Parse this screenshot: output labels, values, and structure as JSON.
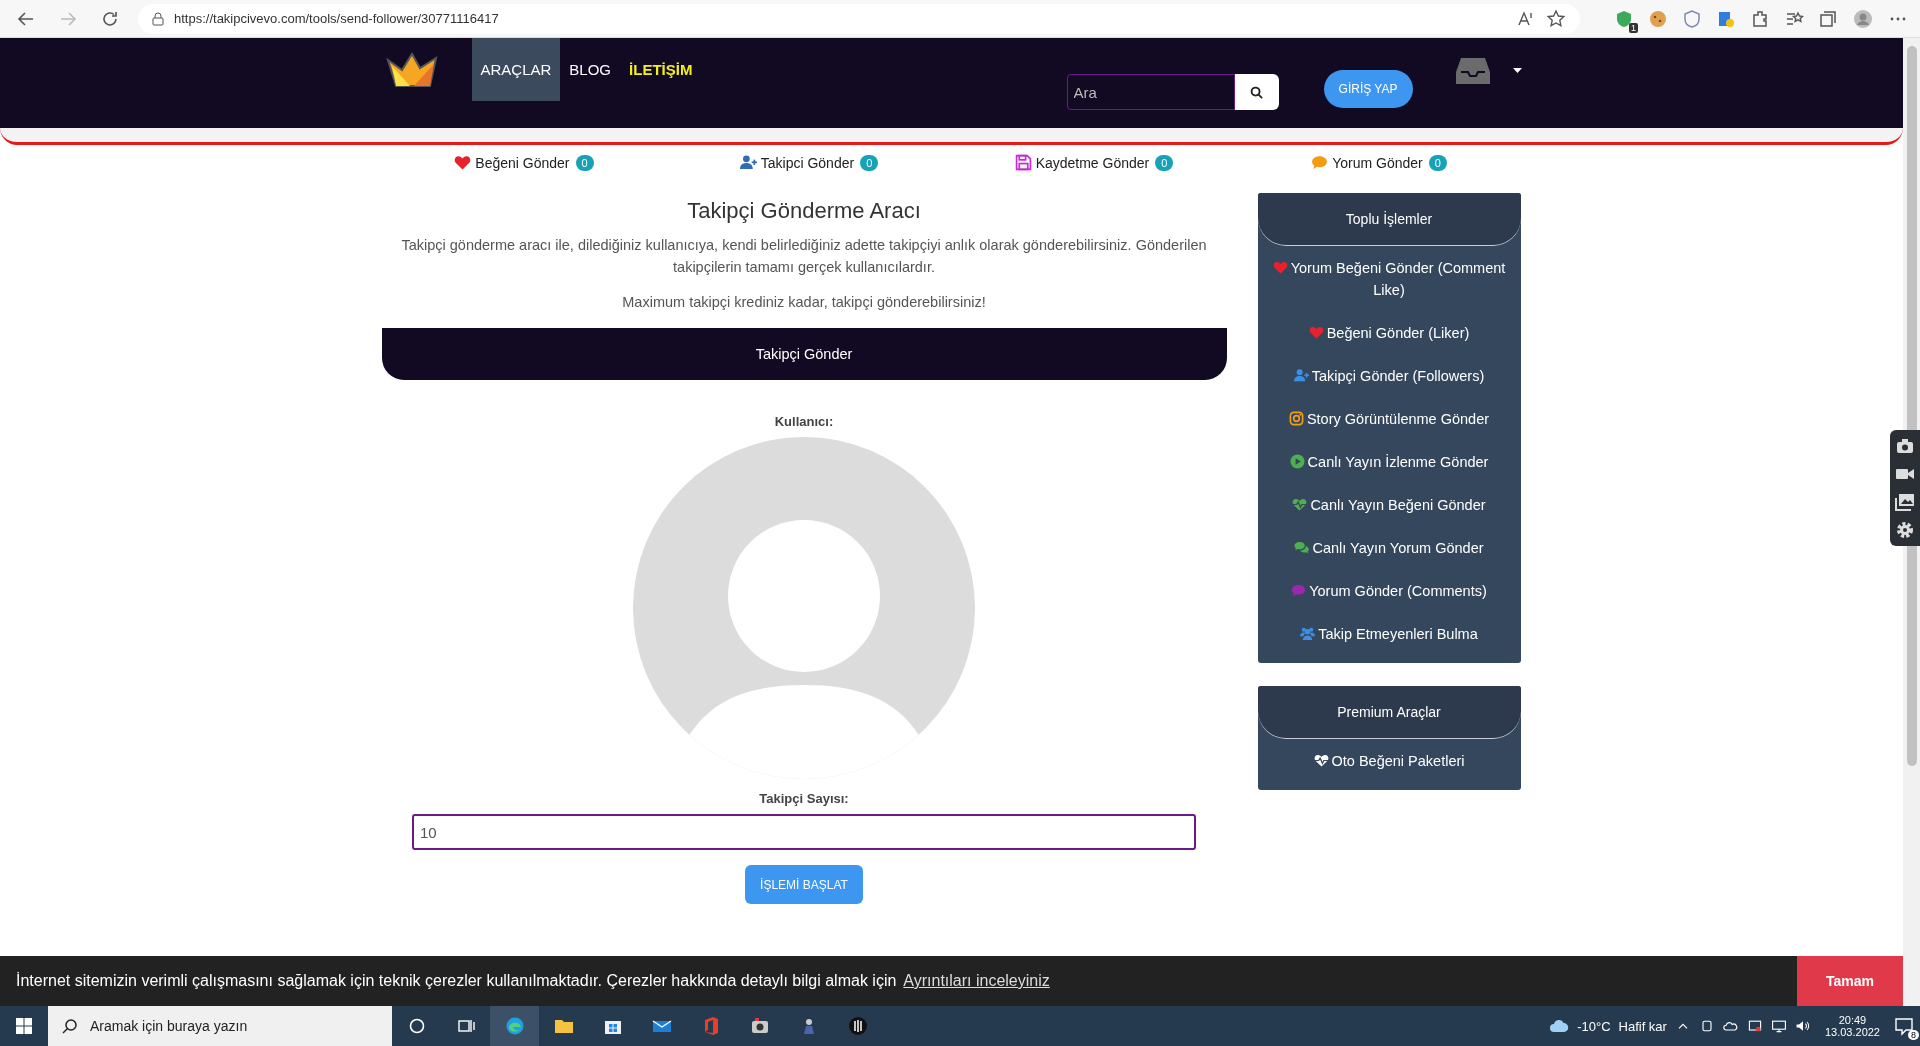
{
  "browser": {
    "url": "https://takipcivevo.com/tools/send-follower/30771116417",
    "extension_badge": "1"
  },
  "navbar": {
    "menu": [
      {
        "label": "ARAÇLAR",
        "selected": true,
        "highlighted": false
      },
      {
        "label": "BLOG",
        "selected": false,
        "highlighted": false
      },
      {
        "label": "İLETİŞİM",
        "selected": false,
        "highlighted": true
      }
    ],
    "search": {
      "placeholder": "Ara"
    },
    "login_button": "GİRİŞ YAP"
  },
  "tools": [
    {
      "label": "Beğeni Gönder",
      "count": "0",
      "kind": "heart",
      "color": "#e8212b"
    },
    {
      "label": "Takipci Gönder",
      "count": "0",
      "kind": "user-plus",
      "color": "#2e6db4"
    },
    {
      "label": "Kaydetme Gönder",
      "count": "0",
      "kind": "save",
      "color": "#c72ad6"
    },
    {
      "label": "Yorum Gönder",
      "count": "0",
      "kind": "comment",
      "color": "#f39c12"
    }
  ],
  "main": {
    "title": "Takipçi Gönderme Aracı",
    "description": "Takipçi gönderme aracı ile, dilediğiniz kullanıcıya, kendi belirlediğiniz adette takipçiyi anlık olarak gönderebilirsiniz. Gönderilen takipçilerin tamamı gerçek kullanıcılardır.",
    "note": "Maximum takipçi krediniz kadar, takipçi gönderebilirsiniz!",
    "banner": "Takipçi Gönder",
    "user_label": "Kullanıcı:",
    "count_label": "Takipçi Sayısı:",
    "count_value": "10",
    "start_button": "İŞLEMİ BAŞLAT"
  },
  "sidebar": [
    {
      "title": "Toplu İşlemler",
      "items": [
        {
          "label": "Yorum Beğeni Gönder (Comment Like)",
          "kind": "heart",
          "color": "#e8212b"
        },
        {
          "label": "Beğeni Gönder (Liker)",
          "kind": "heart",
          "color": "#e8212b"
        },
        {
          "label": "Takipçi Gönder (Followers)",
          "kind": "user-plus",
          "color": "#3d8fe6"
        },
        {
          "label": "Story Görüntülenme Gönder",
          "kind": "instagram",
          "color": "#f39c12"
        },
        {
          "label": "Canlı Yayın İzlenme Gönder",
          "kind": "play",
          "color": "#4caf50"
        },
        {
          "label": "Canlı Yayın Beğeni Gönder",
          "kind": "heartbeat",
          "color": "#4caf50"
        },
        {
          "label": "Canlı Yayın Yorum Gönder",
          "kind": "comments",
          "color": "#4caf50"
        },
        {
          "label": "Yorum Gönder (Comments)",
          "kind": "comment",
          "color": "#9c27b0"
        },
        {
          "label": "Takip Etmeyenleri Bulma",
          "kind": "users",
          "color": "#3d8fe6"
        }
      ]
    },
    {
      "title": "Premium Araçlar",
      "items": [
        {
          "label": "Oto Beğeni Paketleri",
          "kind": "heartbeat",
          "color": "#ffffff"
        }
      ]
    }
  ],
  "cookie_bar": {
    "text": "İnternet sitemizin verimli çalışmasını sağlamak için teknik çerezler kullanılmaktadır. Çerezler hakkında detaylı bilgi almak için",
    "link": "Ayrıntıları inceleyiniz",
    "button": "Tamam"
  },
  "taskbar": {
    "search_placeholder": "Aramak için buraya yazın",
    "temperature": "-10°C",
    "weather": "Hafif kar",
    "time": "20:49",
    "date": "13.03.2022",
    "notifications": "8"
  }
}
